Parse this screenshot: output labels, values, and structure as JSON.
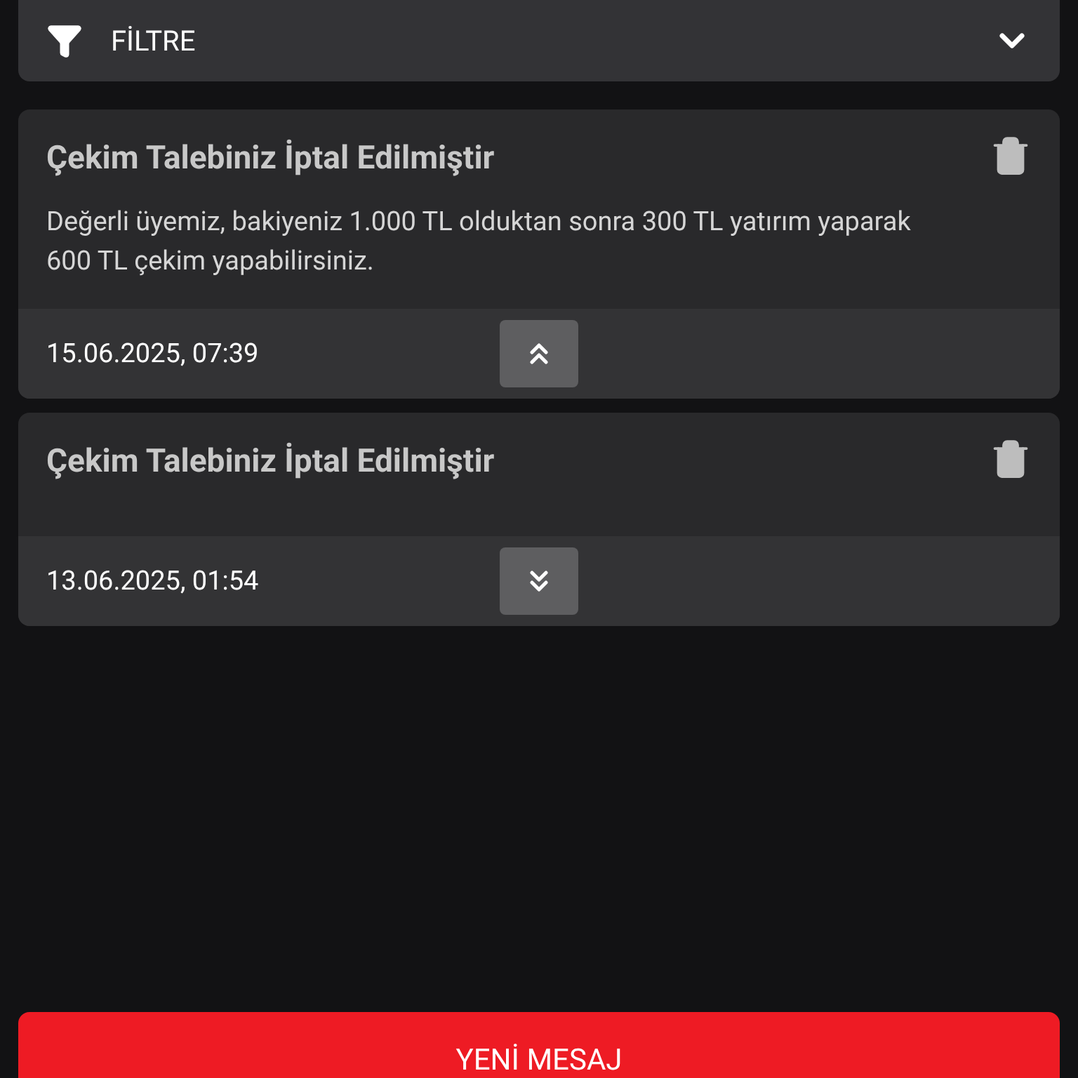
{
  "filter": {
    "label": "FİLTRE",
    "expanded": false
  },
  "messages": [
    {
      "title": "Çekim Talebiniz İptal Edilmiştir",
      "body": "Değerli üyemiz, bakiyeniz 1.000 TL olduktan sonra 300 TL yatırım yaparak 600 TL çekim yapabilirsiniz.",
      "date": "15.06.2025, 07:39",
      "expanded": true
    },
    {
      "title": "Çekim Talebiniz İptal Edilmiştir",
      "date": "13.06.2025, 01:54",
      "expanded": false
    }
  ],
  "new_message_button": "YENİ MESAJ"
}
